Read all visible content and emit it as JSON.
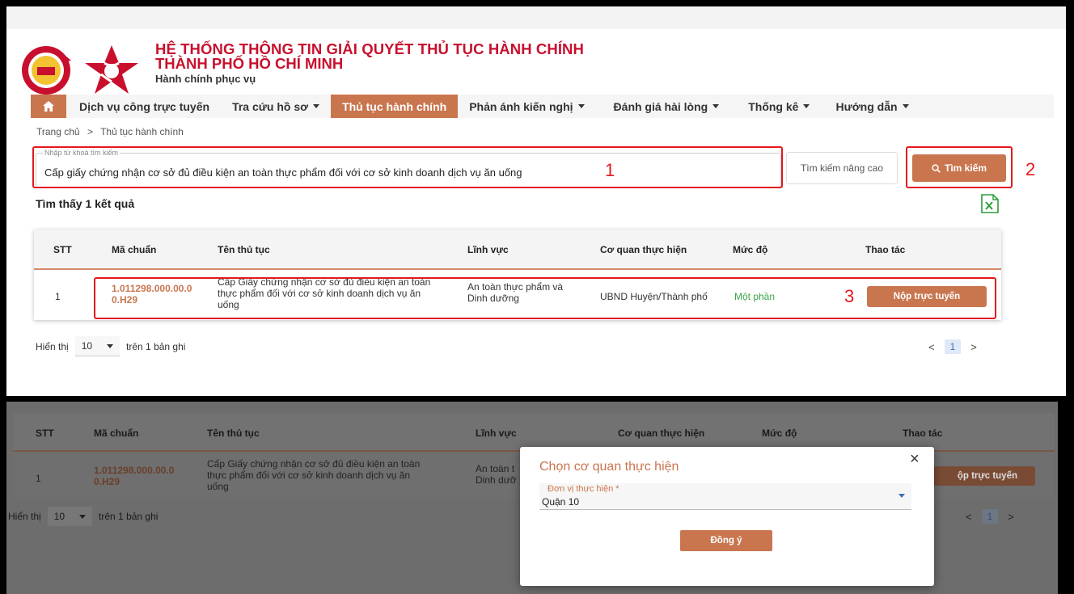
{
  "header": {
    "title_line1": "HỆ THỐNG THÔNG TIN GIẢI QUYẾT THỦ TỤC HÀNH CHÍNH",
    "title_line2": "THÀNH PHỐ HỒ CHÍ MINH",
    "subtitle": "Hành chính phục vụ"
  },
  "nav": {
    "items": [
      {
        "label": "Dịch vụ công trực tuyến",
        "dropdown": false,
        "active": false
      },
      {
        "label": "Tra cứu hồ sơ",
        "dropdown": true,
        "active": false
      },
      {
        "label": "Thủ tục hành chính",
        "dropdown": false,
        "active": true
      },
      {
        "label": "Phản ánh kiến nghị",
        "dropdown": true,
        "active": false
      },
      {
        "label": "Đánh giá hài lòng",
        "dropdown": true,
        "active": false
      },
      {
        "label": "Thống kê",
        "dropdown": true,
        "active": false
      },
      {
        "label": "Hướng dẫn",
        "dropdown": true,
        "active": false
      }
    ]
  },
  "breadcrumb": {
    "home": "Trang chủ",
    "separator": ">",
    "current": "Thủ tục hành chính"
  },
  "search": {
    "label": "Nhập từ khoá tìm kiếm",
    "value": "Cấp giấy chứng nhận cơ sở đủ điều kiện an toàn thực phẩm đối với cơ sở kinh doanh dịch vụ ăn uống",
    "advanced_label": "Tìm kiếm nâng cao",
    "button_label": "Tìm kiếm"
  },
  "annotations": {
    "one": "1",
    "two": "2",
    "three": "3"
  },
  "results": {
    "count_label": "Tìm thấy 1 kết quả",
    "columns": {
      "stt": "STT",
      "code": "Mã chuẩn",
      "name": "Tên thủ tục",
      "field": "Lĩnh vực",
      "agency": "Cơ quan thực hiện",
      "level": "Mức độ",
      "action": "Thao tác"
    },
    "row": {
      "stt": "1",
      "code_line1": "1.011298.000.00.0",
      "code_line2": "0.H29",
      "name_line1": "Cấp Giấy chứng nhận cơ sở đủ điều kiện an toàn",
      "name_line2": "thực phẩm đối với cơ sở kinh doanh dịch vụ ăn",
      "name_line3": "uống",
      "field_line1": "An toàn thực phẩm và",
      "field_line2": "Dinh dưỡng",
      "field_short1": "An toàn t",
      "field_short2": "Dinh dưỡ",
      "agency": "UBND Huyện/Thành phố",
      "level": "Một phần",
      "action": "Nộp trực tuyến",
      "action_clipped": "ộp trực tuyến"
    }
  },
  "pagination": {
    "show_label": "Hiển thị",
    "page_size": "10",
    "total_label": "trên 1 bản ghi",
    "prev": "<",
    "current_page": "1",
    "next": ">"
  },
  "modal": {
    "title": "Chọn cơ quan thực hiện",
    "close": "×",
    "field_label": "Đơn vị thực hiện *",
    "field_value": "Quận 10",
    "confirm": "Đồng ý"
  },
  "colors": {
    "brand": "#c9764f",
    "title_red": "#c8102e",
    "highlight_red": "#e4181b",
    "level_green": "#3aa34a"
  }
}
